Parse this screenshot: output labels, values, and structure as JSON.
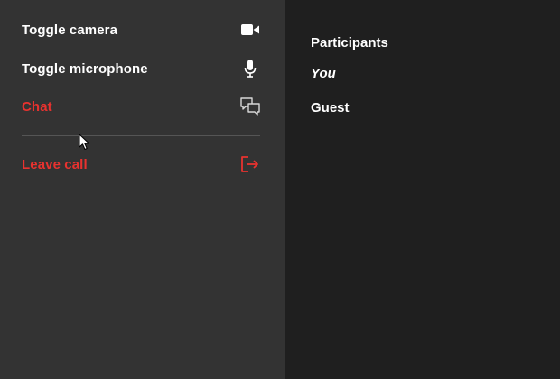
{
  "menu": {
    "items": [
      {
        "label": "Toggle camera",
        "icon": "video-camera-icon",
        "danger": false
      },
      {
        "label": "Toggle microphone",
        "icon": "microphone-icon",
        "danger": false
      },
      {
        "label": "Chat",
        "icon": "chat-icon",
        "danger": true
      },
      {
        "label": "Leave call",
        "icon": "leave-icon",
        "danger": true
      }
    ]
  },
  "participants": {
    "title": "Participants",
    "list": [
      {
        "name": "You"
      },
      {
        "name": "Guest"
      }
    ]
  },
  "colors": {
    "menu_background": "#333333",
    "panel_background": "#1f1f1f",
    "danger": "#e8322f",
    "text": "#ffffff"
  }
}
